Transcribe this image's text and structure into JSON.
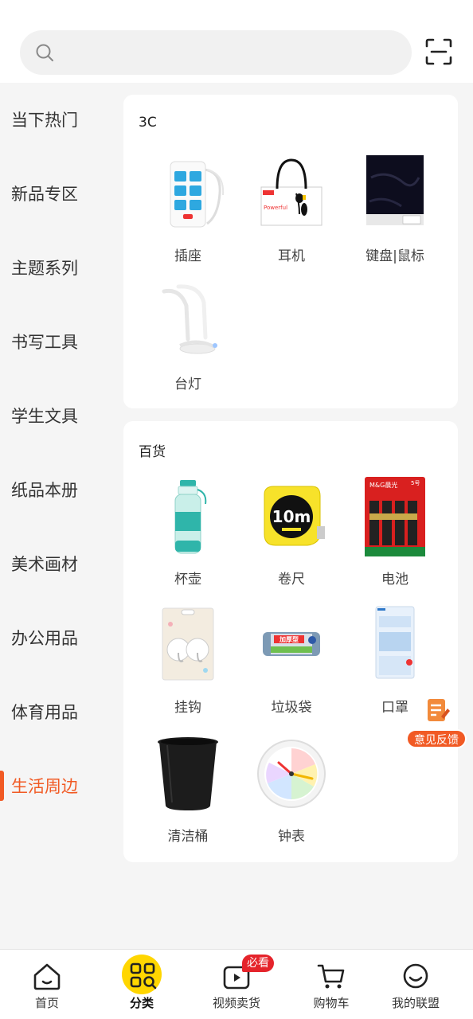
{
  "search": {
    "placeholder": ""
  },
  "sidebar": {
    "items": [
      {
        "label": "当下热门"
      },
      {
        "label": "新品专区"
      },
      {
        "label": "主题系列"
      },
      {
        "label": "书写工具"
      },
      {
        "label": "学生文具"
      },
      {
        "label": "纸品本册"
      },
      {
        "label": "美术画材"
      },
      {
        "label": "办公用品"
      },
      {
        "label": "体育用品"
      },
      {
        "label": "生活周边"
      }
    ],
    "active_index": 9
  },
  "sections": [
    {
      "title": "3C",
      "products": [
        {
          "name": "插座",
          "icon": "power-strip-image"
        },
        {
          "name": "耳机",
          "icon": "earphones-image"
        },
        {
          "name": "键盘|鼠标",
          "icon": "mouse-pad-image"
        },
        {
          "name": "台灯",
          "icon": "desk-lamp-image"
        }
      ]
    },
    {
      "title": "百货",
      "products": [
        {
          "name": "杯壶",
          "icon": "water-bottle-image"
        },
        {
          "name": "卷尺",
          "icon": "tape-measure-image"
        },
        {
          "name": "电池",
          "icon": "battery-pack-image"
        },
        {
          "name": "挂钩",
          "icon": "hooks-image"
        },
        {
          "name": "垃圾袋",
          "icon": "trash-bag-roll-image"
        },
        {
          "name": "口罩",
          "icon": "mask-pack-image"
        },
        {
          "name": "清洁桶",
          "icon": "waste-bin-image"
        },
        {
          "name": "钟表",
          "icon": "clock-image"
        }
      ]
    }
  ],
  "product_art": {
    "tape_label": "10m",
    "battery_brand": "M&G晨光",
    "battery_size": "5号",
    "trash_bag_label": "加厚型",
    "earphone_brand": "Powerful"
  },
  "feedback": {
    "label": "意见反馈"
  },
  "tabbar": {
    "tabs": [
      {
        "label": "首页",
        "icon": "home-icon"
      },
      {
        "label": "分类",
        "icon": "category-icon"
      },
      {
        "label": "视频卖货",
        "icon": "video-icon"
      },
      {
        "label": "购物车",
        "icon": "cart-icon"
      },
      {
        "label": "我的联盟",
        "icon": "smile-icon"
      }
    ],
    "active_index": 1,
    "video_badge": "必看"
  },
  "colors": {
    "accent": "#f15a24",
    "active_tab": "#ffd600",
    "badge": "#e5242b"
  }
}
